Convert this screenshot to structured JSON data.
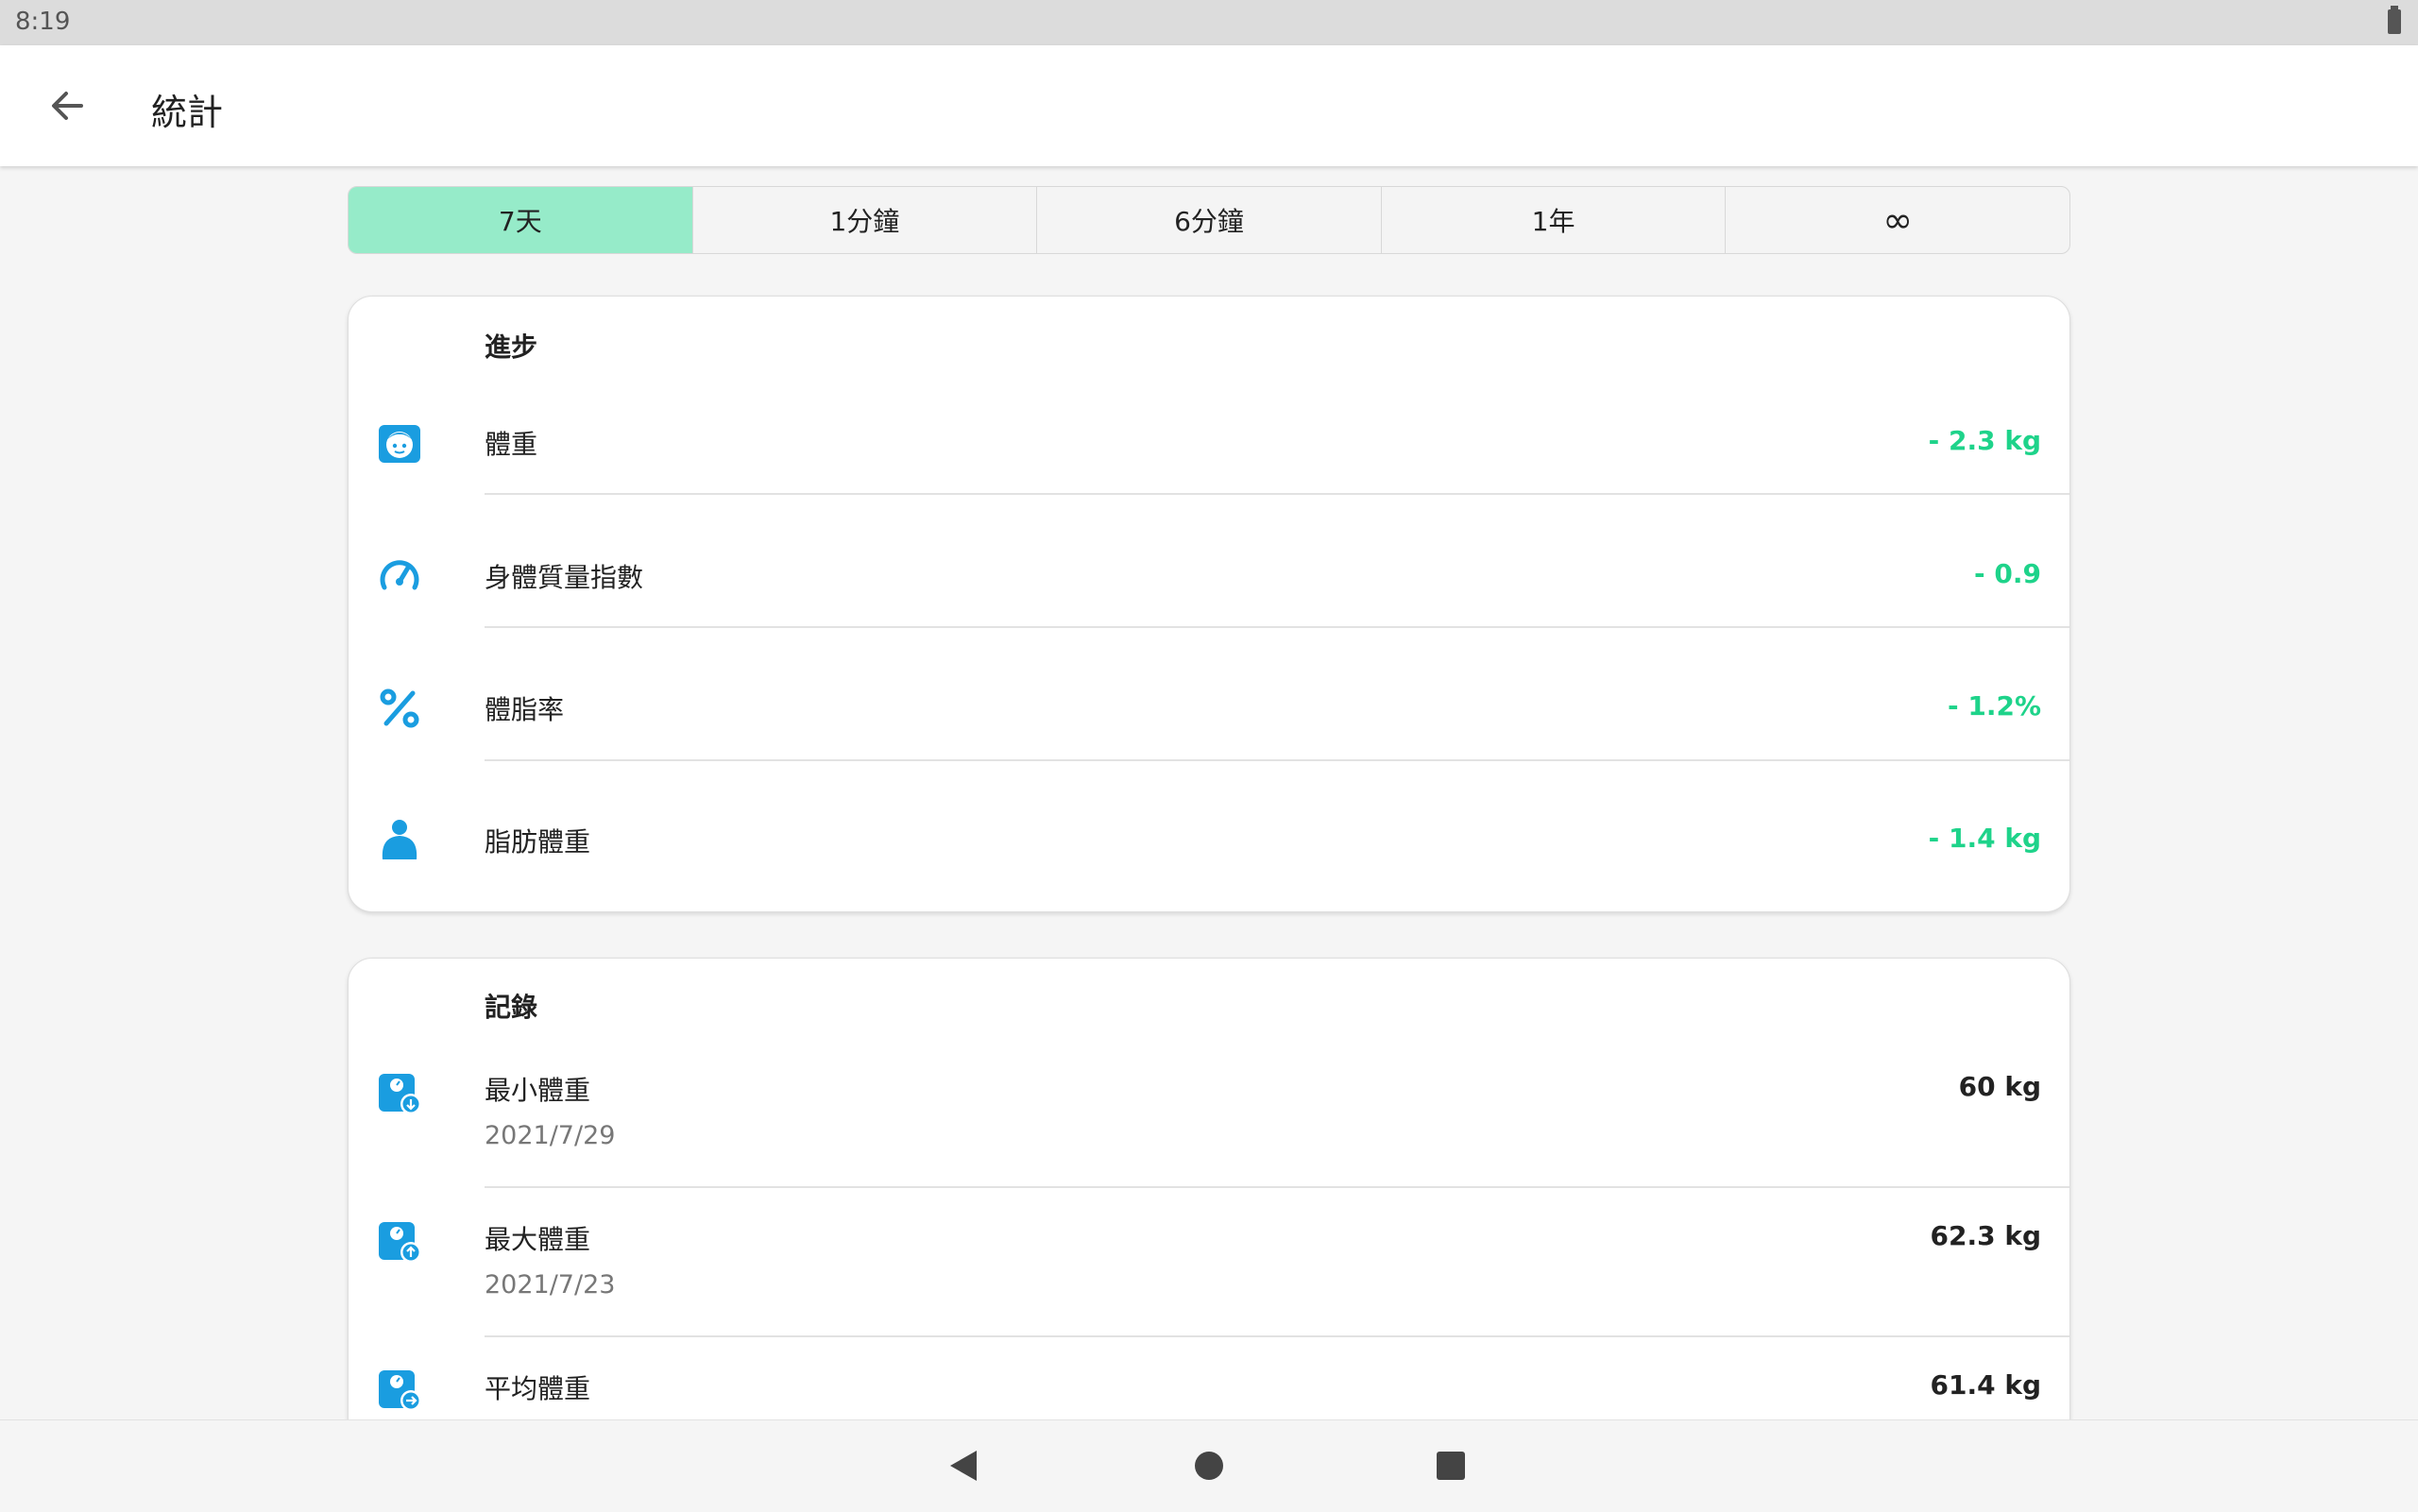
{
  "status_bar": {
    "time": "8:19"
  },
  "app_bar": {
    "title": "統計"
  },
  "tabs": [
    {
      "label": "7天",
      "active": true
    },
    {
      "label": "1分鐘",
      "active": false
    },
    {
      "label": "6分鐘",
      "active": false
    },
    {
      "label": "1年",
      "active": false
    },
    {
      "label": "∞",
      "active": false
    }
  ],
  "progress_card": {
    "title": "進步",
    "rows": [
      {
        "icon": "face-icon",
        "label": "體重",
        "value": "- 2.3 kg"
      },
      {
        "icon": "speedometer-icon",
        "label": "身體質量指數",
        "value": "- 0.9"
      },
      {
        "icon": "percent-icon",
        "label": "體脂率",
        "value": "- 1.2%"
      },
      {
        "icon": "body-icon",
        "label": "脂肪體重",
        "value": "- 1.4 kg"
      }
    ]
  },
  "records_card": {
    "title": "記錄",
    "rows": [
      {
        "icon": "scale-min-icon",
        "label": "最小體重",
        "date": "2021/7/29",
        "value": "60 kg"
      },
      {
        "icon": "scale-max-icon",
        "label": "最大體重",
        "date": "2021/7/23",
        "value": "62.3 kg"
      },
      {
        "icon": "scale-avg-icon",
        "label": "平均體重",
        "value": "61.4 kg"
      }
    ]
  },
  "colors": {
    "accent_tab": "#96ebc9",
    "icon_blue": "#1a9de0",
    "value_green": "#1ed38a"
  }
}
